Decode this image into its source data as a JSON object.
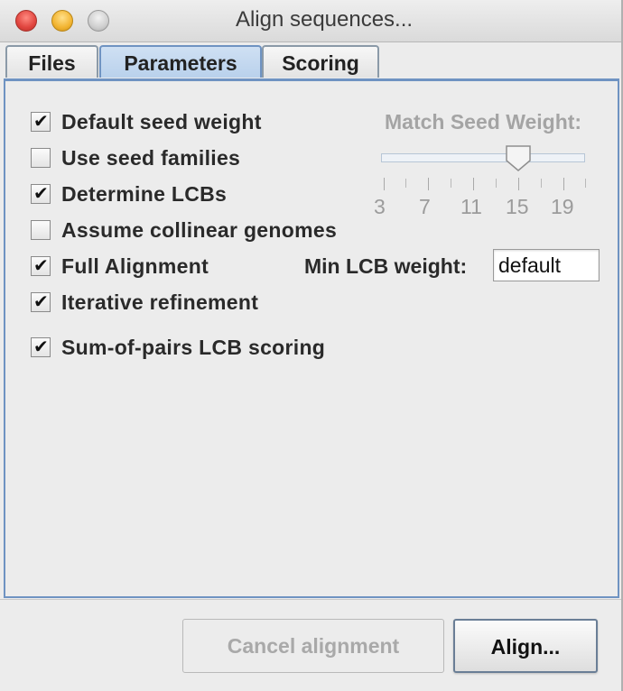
{
  "window": {
    "title": "Align sequences..."
  },
  "tabs": [
    {
      "label": "Files",
      "selected": false
    },
    {
      "label": "Parameters",
      "selected": true
    },
    {
      "label": "Scoring",
      "selected": false
    }
  ],
  "options": [
    {
      "label": "Default seed weight",
      "checked": true
    },
    {
      "label": "Use seed families",
      "checked": false
    },
    {
      "label": "Determine LCBs",
      "checked": true
    },
    {
      "label": "Assume collinear genomes",
      "checked": false
    },
    {
      "label": "Full Alignment",
      "checked": true
    },
    {
      "label": "Iterative refinement",
      "checked": true
    },
    {
      "label": "Sum-of-pairs LCB scoring",
      "checked": true
    }
  ],
  "seed_slider": {
    "label": "Match Seed Weight:",
    "enabled": false,
    "min": 3,
    "max": 21,
    "value": 15,
    "tick_labels": [
      "3",
      "7",
      "11",
      "15",
      "19"
    ]
  },
  "min_lcb": {
    "label": "Min LCB weight:",
    "value": "default"
  },
  "buttons": {
    "cancel_label": "Cancel alignment",
    "cancel_enabled": false,
    "align_label": "Align..."
  },
  "colors": {
    "tab_selected": "#b9d1ec",
    "panel_border": "#6f93c2",
    "disabled_text": "#a4a4a4"
  }
}
